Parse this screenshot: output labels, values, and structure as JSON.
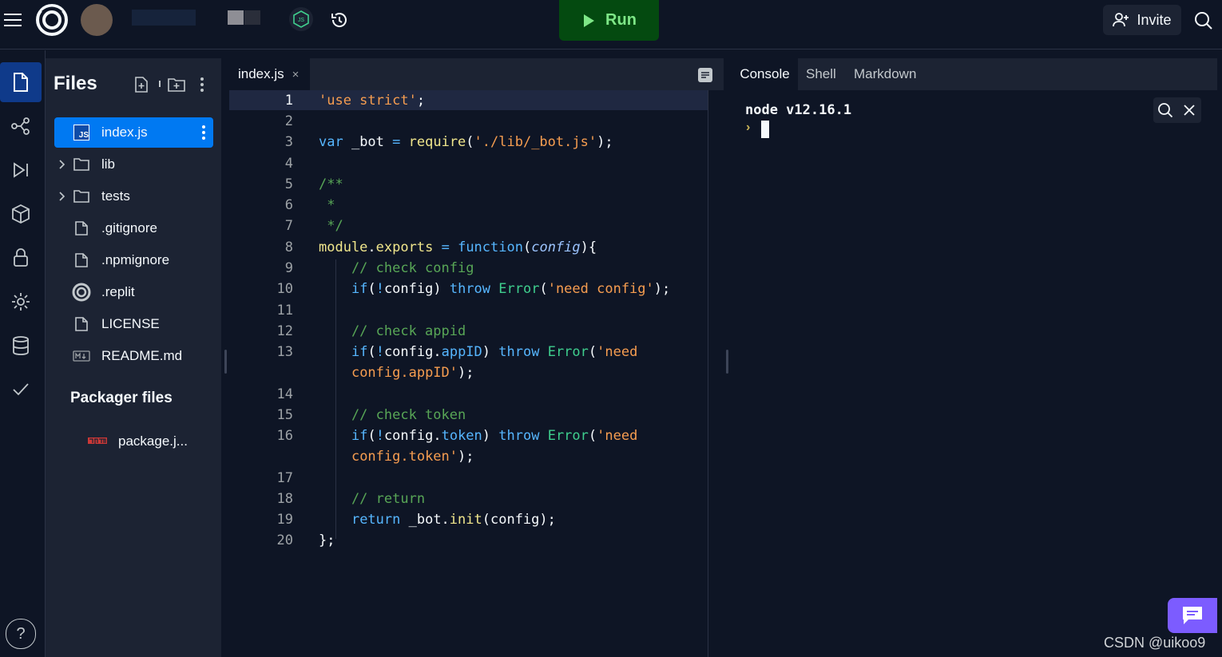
{
  "topbar": {
    "run_label": "Run",
    "invite_label": "Invite",
    "language_badge": "JS",
    "colors": {
      "run_bg": "#044a10",
      "run_text": "#7ee787",
      "accent": "#0079f2"
    }
  },
  "rail": {
    "items": [
      "files-icon",
      "git-icon",
      "debugger-icon",
      "packages-icon",
      "secrets-icon",
      "settings-icon",
      "database-icon",
      "unit-tests-icon"
    ],
    "help_label": "?"
  },
  "files": {
    "title": "Files",
    "items": [
      {
        "label": "index.js",
        "icon": "js-file-icon",
        "active": true
      },
      {
        "label": "lib",
        "icon": "folder-icon"
      },
      {
        "label": "tests",
        "icon": "folder-icon"
      },
      {
        "label": ".gitignore",
        "icon": "file-icon"
      },
      {
        "label": ".npmignore",
        "icon": "file-icon"
      },
      {
        "label": ".replit",
        "icon": "replit-icon"
      },
      {
        "label": "LICENSE",
        "icon": "file-icon"
      },
      {
        "label": "README.md",
        "icon": "markdown-icon"
      }
    ],
    "packager_title": "Packager files",
    "packager_items": [
      {
        "label": "package.j...",
        "icon": "npm-icon"
      }
    ]
  },
  "editor": {
    "tab_label": "index.js",
    "tab_close": "×",
    "line_numbers": [
      "1",
      "2",
      "3",
      "4",
      "5",
      "6",
      "7",
      "8",
      "9",
      "10",
      "11",
      "12",
      "13",
      "",
      "14",
      "15",
      "16",
      "",
      "17",
      "18",
      "19",
      "20"
    ]
  },
  "console": {
    "tabs": [
      "Console",
      "Shell",
      "Markdown"
    ],
    "node_version": "node v12.16.1",
    "prompt": "›"
  },
  "watermark": "CSDN @uikoo9"
}
